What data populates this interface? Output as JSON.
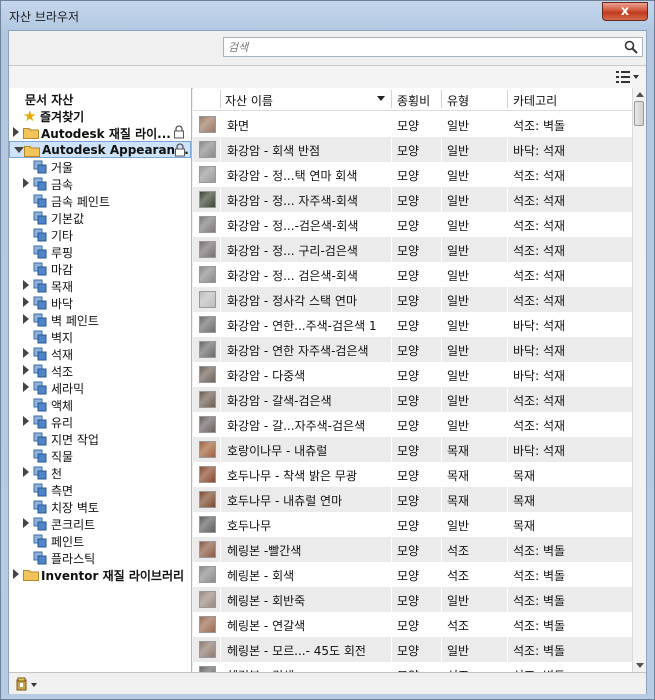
{
  "window": {
    "title": "자산 브라우저",
    "close_label": "x"
  },
  "search": {
    "placeholder": "검색",
    "value": ""
  },
  "left_panel": {
    "title": "문서 자산",
    "favorites": "즐겨찾기",
    "libraries": [
      {
        "label": "Autodesk 재질 라이...",
        "locked": true,
        "expanded": false
      },
      {
        "label": "Autodesk Appearan...",
        "locked": true,
        "expanded": true,
        "selected": true
      },
      {
        "label": "Inventor 재질 라이브러리",
        "locked": false,
        "expanded": false
      }
    ],
    "categories": [
      {
        "label": "거울",
        "expandable": false
      },
      {
        "label": "금속",
        "expandable": true
      },
      {
        "label": "금속 페인트",
        "expandable": false
      },
      {
        "label": "기본값",
        "expandable": false
      },
      {
        "label": "기타",
        "expandable": false
      },
      {
        "label": "루핑",
        "expandable": false
      },
      {
        "label": "마감",
        "expandable": false
      },
      {
        "label": "목재",
        "expandable": true
      },
      {
        "label": "바닥",
        "expandable": true
      },
      {
        "label": "벽 페인트",
        "expandable": true
      },
      {
        "label": "벽지",
        "expandable": false
      },
      {
        "label": "석재",
        "expandable": true
      },
      {
        "label": "석조",
        "expandable": true
      },
      {
        "label": "세라믹",
        "expandable": true
      },
      {
        "label": "액체",
        "expandable": false
      },
      {
        "label": "유리",
        "expandable": true
      },
      {
        "label": "지면 작업",
        "expandable": false
      },
      {
        "label": "직물",
        "expandable": false
      },
      {
        "label": "천",
        "expandable": true
      },
      {
        "label": "측면",
        "expandable": false
      },
      {
        "label": "치장 벽토",
        "expandable": false
      },
      {
        "label": "콘크리트",
        "expandable": true
      },
      {
        "label": "페인트",
        "expandable": false
      },
      {
        "label": "플라스틱",
        "expandable": false
      }
    ]
  },
  "table": {
    "columns": [
      "자산 이름",
      "종횡비",
      "유형",
      "카테고리"
    ],
    "rows": [
      {
        "name": "화면",
        "type": "모양",
        "kind": "일반",
        "category": "석조: 벽돌",
        "swatch": "#9b7a66"
      },
      {
        "name": "화강암 - 회색 반점",
        "type": "모양",
        "kind": "일반",
        "category": "바닥: 석재",
        "swatch": "#8a8a8a"
      },
      {
        "name": "화강암 - 정...택 연마 회색",
        "type": "모양",
        "kind": "일반",
        "category": "석조: 석재",
        "swatch": "#9a9a9a"
      },
      {
        "name": "화강암 - 정... 자주색-회색",
        "type": "모양",
        "kind": "일반",
        "category": "석조: 석재",
        "swatch": "#3e4636"
      },
      {
        "name": "화강암 - 정...-검은색-회색",
        "type": "모양",
        "kind": "일반",
        "category": "석조: 석재",
        "swatch": "#7e7a7a"
      },
      {
        "name": "화강암 - 정... 구리-검은색",
        "type": "모양",
        "kind": "일반",
        "category": "석조: 석재",
        "swatch": "#777070"
      },
      {
        "name": "화강암 - 정... 검은색-회색",
        "type": "모양",
        "kind": "일반",
        "category": "석조: 석재",
        "swatch": "#8a8a8a"
      },
      {
        "name": "화강암 - 정사각 스택 연마",
        "type": "모양",
        "kind": "일반",
        "category": "석조: 석재",
        "swatch": "#bdbdbd"
      },
      {
        "name": "화강암 - 연한...주색-검은색 1",
        "type": "모양",
        "kind": "일반",
        "category": "바닥: 석재",
        "swatch": "#6e6e6e"
      },
      {
        "name": "화강암 - 연한 자주색-검은색",
        "type": "모양",
        "kind": "일반",
        "category": "바닥: 석재",
        "swatch": "#6a6a6a"
      },
      {
        "name": "화강암 - 다중색",
        "type": "모양",
        "kind": "일반",
        "category": "바닥: 석재",
        "swatch": "#6f625a"
      },
      {
        "name": "화강암 - 갈색-검은색",
        "type": "모양",
        "kind": "일반",
        "category": "석조: 석재",
        "swatch": "#6d5d52"
      },
      {
        "name": "화강암 - 갈...자주색-검은색",
        "type": "모양",
        "kind": "일반",
        "category": "석조: 석재",
        "swatch": "#6b6060"
      },
      {
        "name": "호랑이나무 - 내츄럴",
        "type": "모양",
        "kind": "목재",
        "category": "바닥: 석재",
        "swatch": "#a0623a"
      },
      {
        "name": "호두나무 - 착색 밝은 무광",
        "type": "모양",
        "kind": "목재",
        "category": "목재",
        "swatch": "#8a4a2e"
      },
      {
        "name": "호두나무 - 내츄럴 연마",
        "type": "모양",
        "kind": "목재",
        "category": "목재",
        "swatch": "#7b4a2e"
      },
      {
        "name": "호두나무",
        "type": "모양",
        "kind": "일반",
        "category": "목재",
        "swatch": "#5f5f5f"
      },
      {
        "name": "헤링본 -빨간색",
        "type": "모양",
        "kind": "석조",
        "category": "석조: 벽돌",
        "swatch": "#8a5a46"
      },
      {
        "name": "헤링본 - 회색",
        "type": "모양",
        "kind": "석조",
        "category": "석조: 벽돌",
        "swatch": "#8c8c8c"
      },
      {
        "name": "헤링본 - 회반죽",
        "type": "모양",
        "kind": "일반",
        "category": "석조: 벽돌",
        "swatch": "#9a8a80"
      },
      {
        "name": "헤링본 - 연갈색",
        "type": "모양",
        "kind": "석조",
        "category": "석조: 벽돌",
        "swatch": "#9a6a52"
      },
      {
        "name": "헤링본 - 모르...- 45도 회전",
        "type": "모양",
        "kind": "일반",
        "category": "석조: 벽돌",
        "swatch": "#8e7a70"
      },
      {
        "name": "헤링본 - 검색",
        "type": "모양",
        "kind": "석조",
        "category": "석조: 벽돌",
        "swatch": "#6a6a6a"
      }
    ]
  }
}
